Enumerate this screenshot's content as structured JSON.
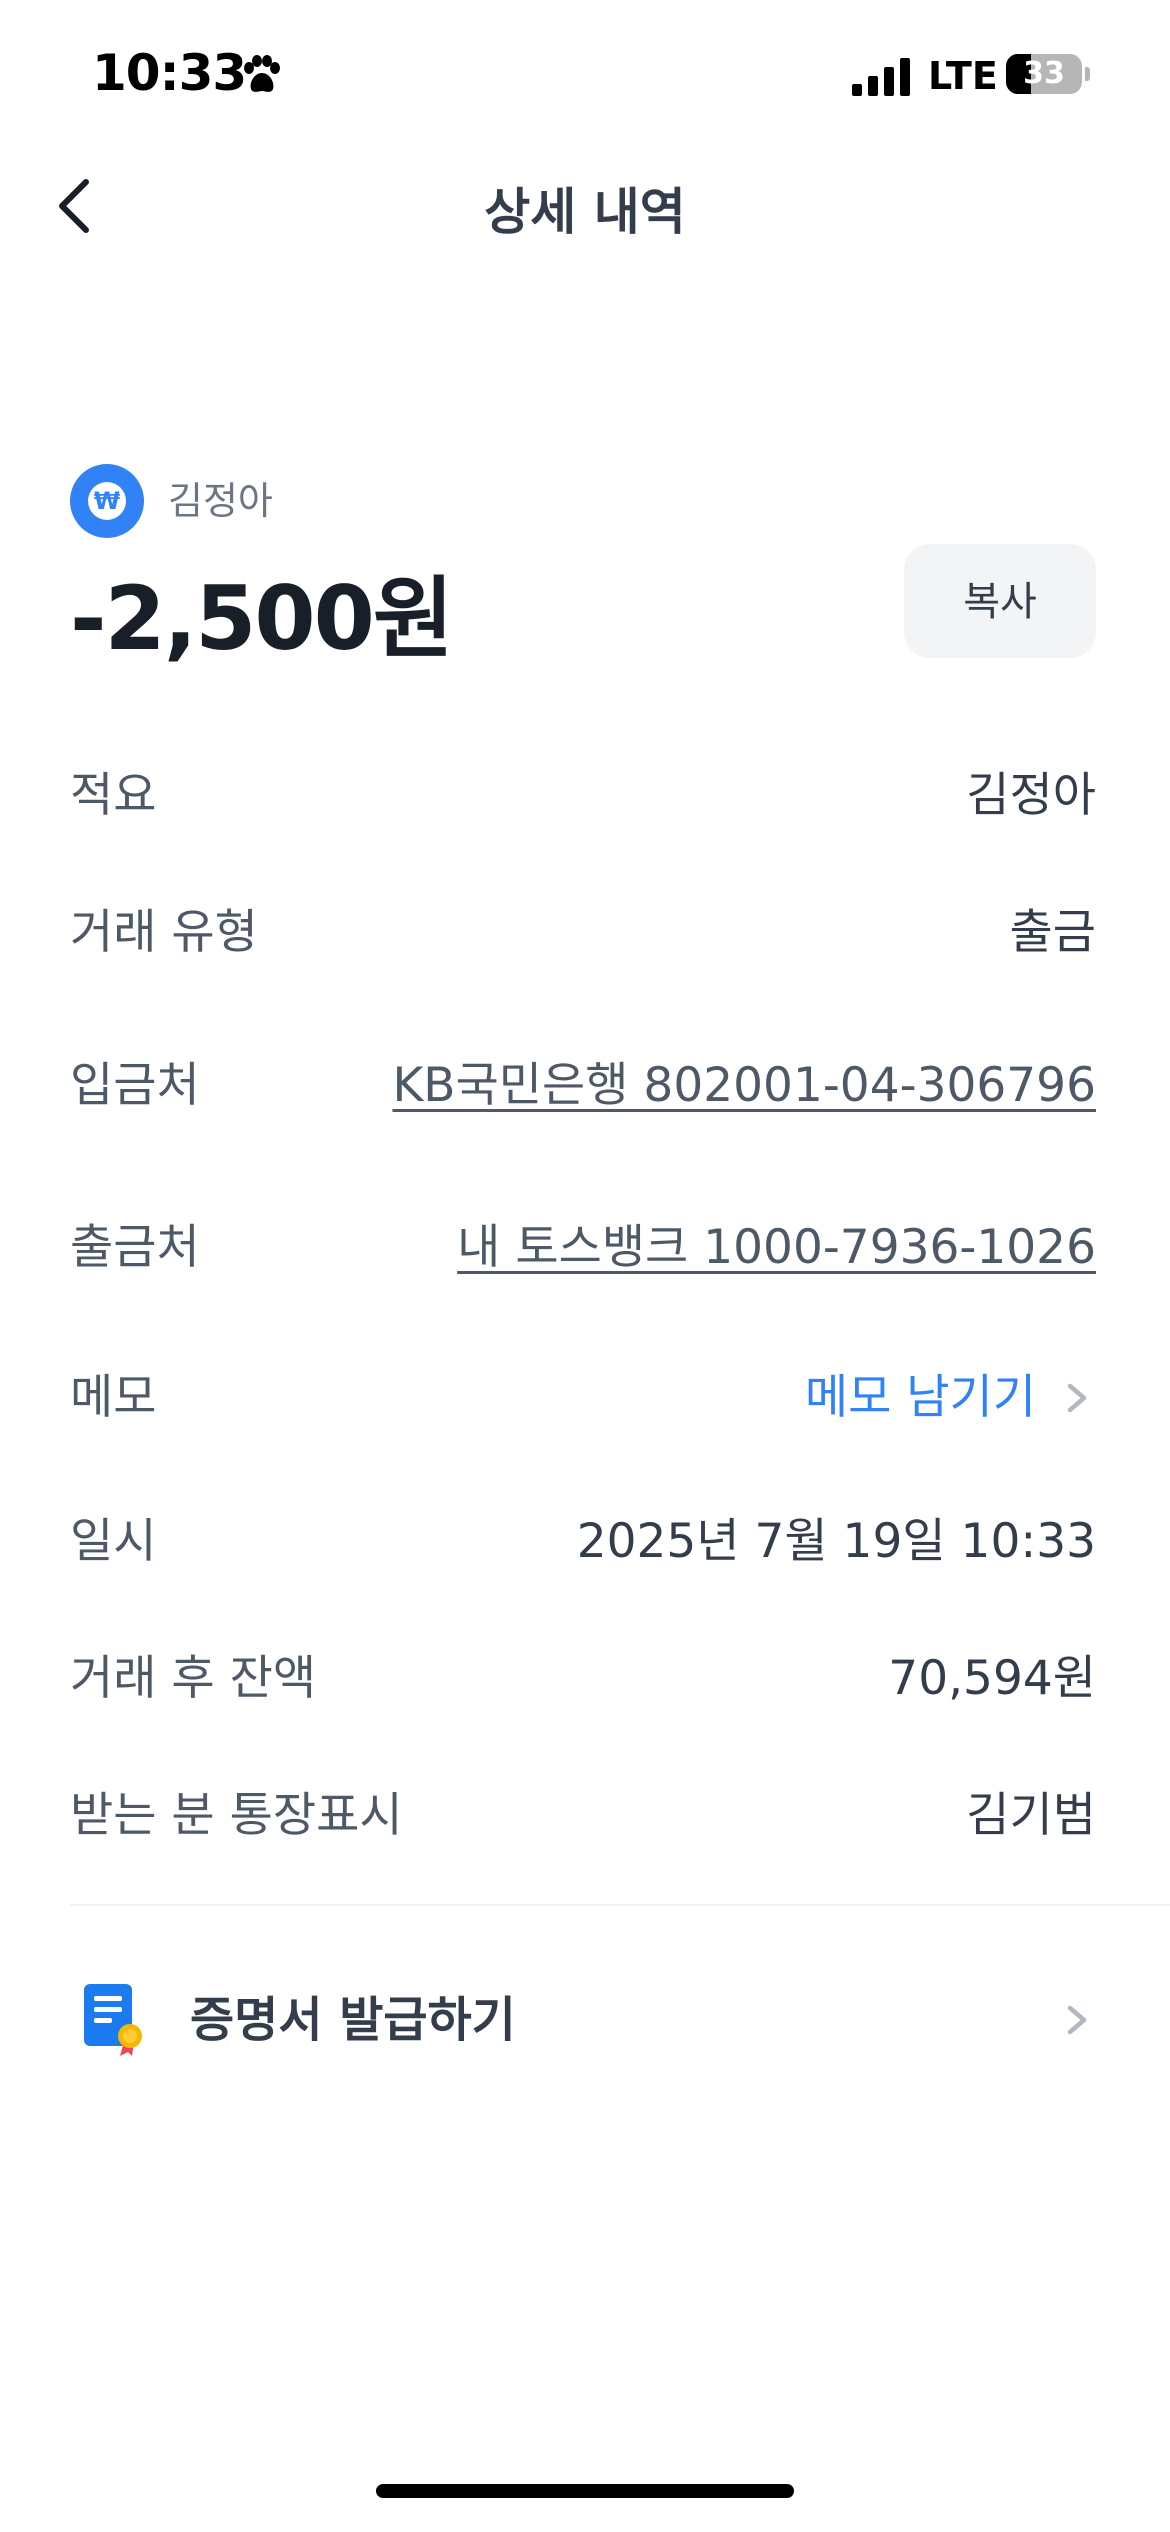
{
  "status_bar": {
    "time": "10:33",
    "network": "LTE",
    "battery_level": "33",
    "battery_fraction": 0.33
  },
  "nav": {
    "title": "상세 내역",
    "back_icon": "chevron-left-icon"
  },
  "header": {
    "avatar_glyph": "₩",
    "recipient_name": "김정아",
    "amount": "-2,500원",
    "copy_label": "복사",
    "accent_color": "#3182f6"
  },
  "details": [
    {
      "label": "적요",
      "value": "김정아"
    },
    {
      "label": "거래 유형",
      "value": "출금"
    },
    {
      "label": "입금처",
      "value": "KB국민은행 802001-04-306796"
    },
    {
      "label": "출금처",
      "value": "내 토스뱅크 1000-7936-1026"
    },
    {
      "label": "메모",
      "value": "메모 남기기"
    },
    {
      "label": "일시",
      "value": "2025년 7월 19일 10:33"
    },
    {
      "label": "거래 후 잔액",
      "value": "70,594원"
    },
    {
      "label": "받는 분 통장표시",
      "value": "김기범"
    }
  ],
  "certificate": {
    "label": "증명서 발급하기",
    "icon": "certificate-icon"
  }
}
